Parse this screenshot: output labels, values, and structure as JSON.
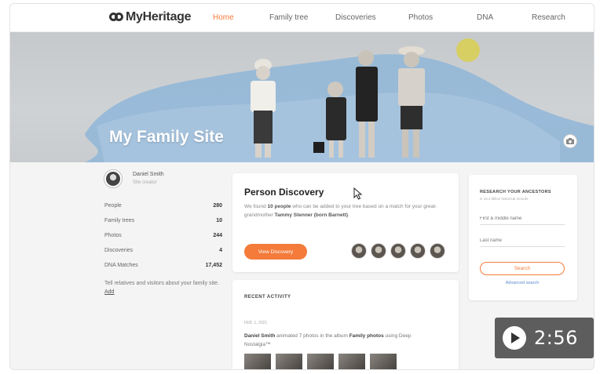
{
  "brand": {
    "name": "MyHeritage"
  },
  "nav": [
    {
      "label": "Home",
      "active": true
    },
    {
      "label": "Family tree"
    },
    {
      "label": "Discoveries"
    },
    {
      "label": "Photos"
    },
    {
      "label": "DNA"
    },
    {
      "label": "Research"
    }
  ],
  "hero": {
    "title": "My Family Site"
  },
  "user": {
    "name": "Daniel Smith",
    "role": "Site creator"
  },
  "stats": [
    {
      "label": "People",
      "value": "280"
    },
    {
      "label": "Family trees",
      "value": "10"
    },
    {
      "label": "Photos",
      "value": "244"
    },
    {
      "label": "Discoveries",
      "value": "4"
    },
    {
      "label": "DNA Matches",
      "value": "17,452"
    }
  ],
  "tell": {
    "text": "Tell relatives and visitors about your family site.",
    "link": "Add"
  },
  "discovery": {
    "title": "Person Discovery",
    "text_pre": "We found ",
    "count": "10 people",
    "text_mid": " who can be added to your tree based on a match for your great-grandmother ",
    "person": "Tammy Stenner (born Barnett)",
    "text_post": ".",
    "button": "View Discovery"
  },
  "activity": {
    "title": "RECENT ACTIVITY",
    "date": "FEB. 1, 2021",
    "actor": "Daniel Smith",
    "text": " animated 7 photos in the album ",
    "album": "Family photos",
    "text_post": " using Deep Nostalgia™"
  },
  "research": {
    "title": "RESEARCH YOUR ANCESTORS",
    "subtitle": "in 18.4 billion historical records",
    "first_placeholder": "First & middle name",
    "last_placeholder": "Last name",
    "search": "Search",
    "advanced": "Advanced search"
  },
  "video": {
    "duration": "2:56"
  },
  "colors": {
    "accent": "#f47b3a",
    "sun": "#d9cf58",
    "watercolor": "#8fb6d8"
  }
}
